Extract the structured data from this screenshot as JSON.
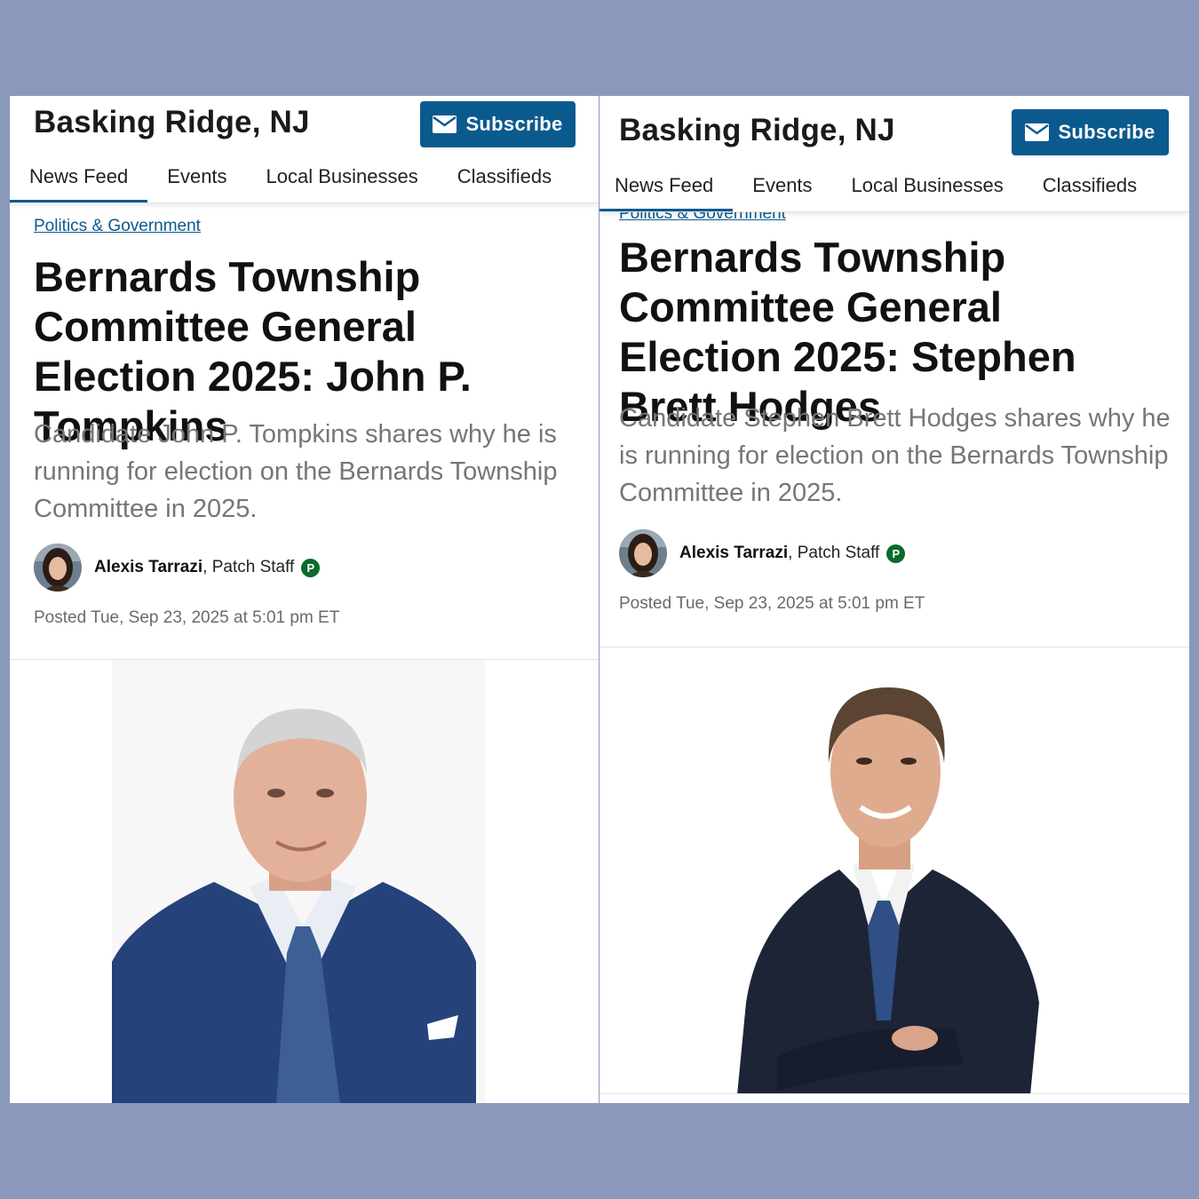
{
  "panels": [
    {
      "site_title": "Basking Ridge, NJ",
      "subscribe_label": "Subscribe",
      "tabs": [
        "News Feed",
        "Events",
        "Local Businesses",
        "Classifieds"
      ],
      "active_tab": "News Feed",
      "category": "Politics & Government",
      "headline": "Bernards Township Committee General Election 2025: John P. Tompkins",
      "dek": "Candidate John P. Tompkins shares why he is running for election on the Bernards Township Committee in 2025.",
      "author": "Alexis Tarrazi",
      "author_role": ", Patch Staff",
      "badge": "P",
      "posted": "Posted Tue, Sep 23, 2025 at 5:01 pm ET"
    },
    {
      "site_title": "Basking Ridge, NJ",
      "subscribe_label": "Subscribe",
      "tabs": [
        "News Feed",
        "Events",
        "Local Businesses",
        "Classifieds"
      ],
      "active_tab": "News Feed",
      "category": "Politics & Government",
      "headline": "Bernards Township Committee General Election 2025: Stephen Brett Hodges",
      "dek": "Candidate Stephen Brett Hodges shares why he is running for election on the Bernards Township Committee in 2025.",
      "author": "Alexis Tarrazi",
      "author_role": ", Patch Staff",
      "badge": "P",
      "posted": "Posted Tue, Sep 23, 2025 at 5:01 pm ET"
    }
  ],
  "colors": {
    "background": "#8a98bb",
    "brand_blue": "#0b5a8e",
    "badge_green": "#0a6b2a",
    "dek_gray": "#767676"
  },
  "icons": [
    "mail-icon",
    "patch-badge-icon"
  ]
}
